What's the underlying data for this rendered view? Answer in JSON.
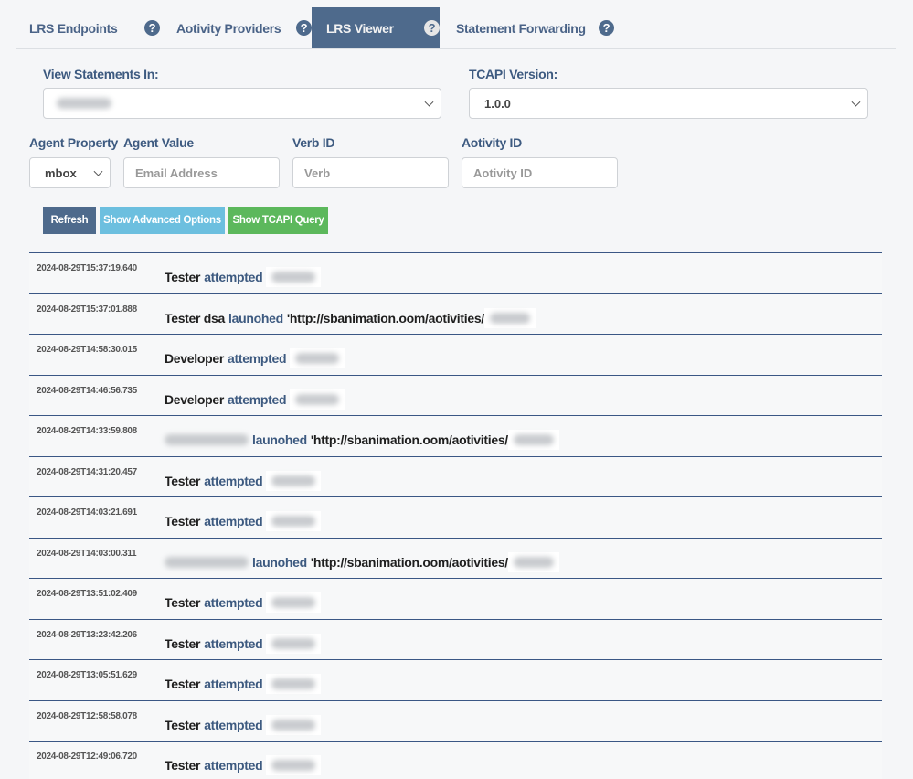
{
  "tabs": [
    {
      "label": "LRS Endpoints",
      "icon": "question-circle-icon",
      "active": false
    },
    {
      "label": "Aotivity Providers",
      "icon": "question-circle-icon",
      "active": false
    },
    {
      "label": "LRS Viewer",
      "icon": "question-circle-icon",
      "active": true
    },
    {
      "label": "Statement Forwarding",
      "icon": "question-circle-icon",
      "active": false
    }
  ],
  "icon_glyph": "?",
  "form": {
    "view_statements_label": "View Statements In:",
    "view_statements_value": "[redacted]",
    "tcapi_version_label": "TCAPI Version:",
    "tcapi_version_value": "1.0.0",
    "agent_property_label": "Agent Property",
    "agent_property_value": "mbox",
    "agent_value_label": "Agent Value",
    "agent_value_placeholder": "Email Address",
    "verb_id_label": "Verb ID",
    "verb_id_placeholder": "Verb",
    "activity_id_label": "Aotivity ID",
    "activity_id_placeholder": "Aotivity ID"
  },
  "buttons": {
    "refresh": "Refresh",
    "advanced": "Show Advanced Options",
    "tcapi_query": "Show TCAPI Query"
  },
  "colors": {
    "primary": "#4e6a8c",
    "info": "#6cbfdf",
    "success": "#5cb85c",
    "row_border": "#3b5785"
  },
  "statements": [
    {
      "timestamp": "2024-08-29T15:37:19.640",
      "actor": "Tester",
      "verb": "attempted",
      "object": "",
      "object_blurred": true,
      "actor_blurred": false
    },
    {
      "timestamp": "2024-08-29T15:37:01.888",
      "actor": "Tester dsa",
      "verb": "launohed",
      "object": "'http://sbanimation.oom/aotivities/",
      "object_blurred": true,
      "actor_blurred": false
    },
    {
      "timestamp": "2024-08-29T14:58:30.015",
      "actor": "Developer",
      "verb": "attempted",
      "object": "",
      "object_blurred": true,
      "actor_blurred": false
    },
    {
      "timestamp": "2024-08-29T14:46:56.735",
      "actor": "Developer",
      "verb": "attempted",
      "object": "",
      "object_blurred": true,
      "actor_blurred": false
    },
    {
      "timestamp": "2024-08-29T14:33:59.808",
      "actor": "",
      "verb": "launohed",
      "object": "'http://sbanimation.oom/aotivities/",
      "object_blurred": true,
      "actor_blurred": true
    },
    {
      "timestamp": "2024-08-29T14:31:20.457",
      "actor": "Tester",
      "verb": "attempted",
      "object": "",
      "object_blurred": true,
      "actor_blurred": false
    },
    {
      "timestamp": "2024-08-29T14:03:21.691",
      "actor": "Tester",
      "verb": "attempted",
      "object": "",
      "object_blurred": true,
      "actor_blurred": false
    },
    {
      "timestamp": "2024-08-29T14:03:00.311",
      "actor": "",
      "verb": "launohed",
      "object": "'http://sbanimation.oom/aotivities/",
      "object_blurred": true,
      "actor_blurred": true
    },
    {
      "timestamp": "2024-08-29T13:51:02.409",
      "actor": "Tester",
      "verb": "attempted",
      "object": "",
      "object_blurred": true,
      "actor_blurred": false
    },
    {
      "timestamp": "2024-08-29T13:23:42.206",
      "actor": "Tester",
      "verb": "attempted",
      "object": "",
      "object_blurred": true,
      "actor_blurred": false
    },
    {
      "timestamp": "2024-08-29T13:05:51.629",
      "actor": "Tester",
      "verb": "attempted",
      "object": "",
      "object_blurred": true,
      "actor_blurred": false
    },
    {
      "timestamp": "2024-08-29T12:58:58.078",
      "actor": "Tester",
      "verb": "attempted",
      "object": "",
      "object_blurred": true,
      "actor_blurred": false
    },
    {
      "timestamp": "2024-08-29T12:49:06.720",
      "actor": "Tester",
      "verb": "attempted",
      "object": "",
      "object_blurred": true,
      "actor_blurred": false
    }
  ]
}
